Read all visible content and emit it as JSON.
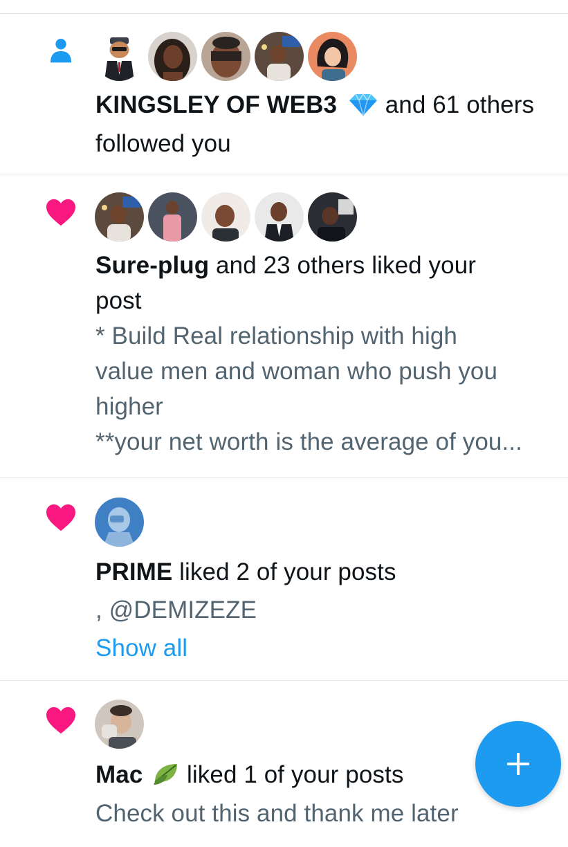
{
  "notifications": [
    {
      "type_icon": "person-icon",
      "avatar_count": 5,
      "actor": "KINGSLEY OF WEB3",
      "actor_badge": "diamond-emoji",
      "action_line1": " and 61 others",
      "action_line2": "followed you"
    },
    {
      "type_icon": "heart-icon",
      "avatar_count": 5,
      "actor": "Sure-plug",
      "action_line1": " and 23 others liked your",
      "action_line2": "post",
      "preview": [
        "* Build Real relationship with high",
        "value men and woman who push you",
        "higher",
        "**your net worth is the average of you..."
      ]
    },
    {
      "type_icon": "heart-icon",
      "avatar_count": 1,
      "actor": "PRIME",
      "action": " liked 2 of your posts",
      "mention_line": ", @DEMIZEZE",
      "show_all": "Show all"
    },
    {
      "type_icon": "heart-icon",
      "avatar_count": 1,
      "actor": "Mac",
      "actor_badge": "leaf-emoji",
      "action": " liked 1 of your posts",
      "preview": "Check out this and thank me later"
    }
  ],
  "fab": {
    "label": "+",
    "icon": "plus-icon"
  },
  "colors": {
    "accent": "#1d9bf0",
    "heart": "#f91880",
    "muted_text": "#536471",
    "divider": "#e6e9ec"
  }
}
